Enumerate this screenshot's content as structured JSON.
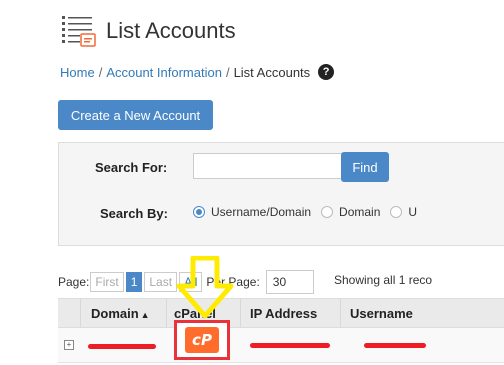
{
  "header": {
    "title": "List Accounts"
  },
  "breadcrumb": {
    "items": [
      {
        "label": "Home"
      },
      {
        "label": "Account Information"
      },
      {
        "label": "List Accounts"
      }
    ],
    "help": "?"
  },
  "actions": {
    "create_label": "Create a New Account"
  },
  "search": {
    "search_for_label": "Search For:",
    "input_value": "",
    "find_label": "Find",
    "search_by_label": "Search By:",
    "options": [
      {
        "label": "Username/Domain",
        "checked": true
      },
      {
        "label": "Domain",
        "checked": false
      },
      {
        "label": "U",
        "checked": false
      }
    ]
  },
  "pagination": {
    "page_label": "Page:",
    "first": "First",
    "current": "1",
    "last": "Last",
    "all": "All",
    "per_page_label": "Per Page:",
    "per_page_value": "30",
    "showing": "Showing all 1 reco"
  },
  "table": {
    "columns": [
      "Domain",
      "cPanel",
      "IP Address",
      "Username"
    ],
    "sort_indicator": "▲",
    "rows": [
      {
        "expander": "+",
        "cpanel_logo": "cP"
      }
    ]
  },
  "colors": {
    "accent": "#4a88c7",
    "redaction": "#ee1c24",
    "highlight_box": "#e8333c",
    "arrow": "#ffeb00",
    "cpanel_orange": "#ff6c2c"
  },
  "icons": {
    "title": "list-accounts-icon",
    "help": "help-circle-icon",
    "arrow": "down-arrow-annotation-icon"
  }
}
